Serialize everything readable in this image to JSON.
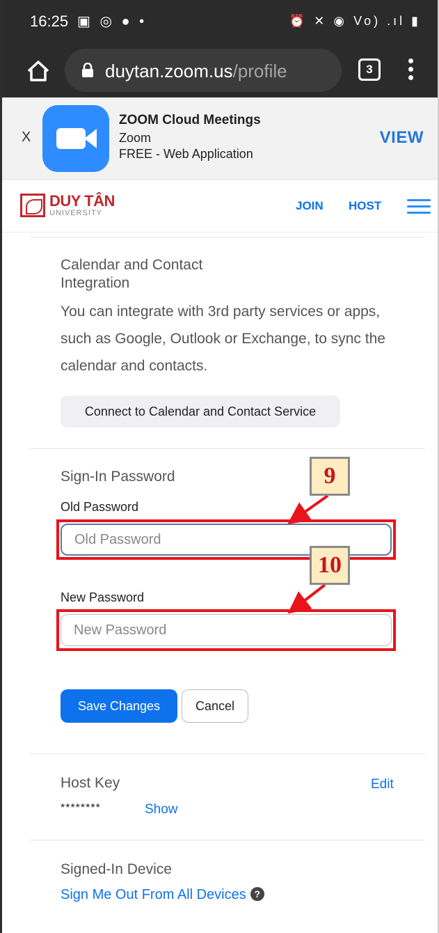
{
  "status_bar": {
    "time": "16:25",
    "left_icons": "▣ ◎ ●  •",
    "right_icons": "⏰ ✕ ◉ Vo) .ıl ▮"
  },
  "browser": {
    "url_host": "duytan.zoom.us",
    "url_path": "/profile",
    "tab_count": "3"
  },
  "app_banner": {
    "close": "X",
    "app_name": "ZOOM Cloud Meetings",
    "publisher": "Zoom",
    "price": "FREE - Web Application",
    "view_label": "VIEW"
  },
  "site_header": {
    "logo_word": "DUY TÂN",
    "logo_sub": "UNIVERSITY",
    "nav": {
      "join": "JOIN",
      "host": "HOST"
    }
  },
  "calendar_section": {
    "title_line1": "Calendar and Contact",
    "title_line2": "Integration",
    "description": "You can integrate with 3rd party services or apps, such as Google, Outlook or Exchange, to sync the calendar and contacts.",
    "connect_button": "Connect to Calendar and Contact Service"
  },
  "password_section": {
    "title": "Sign-In Password",
    "old_label": "Old Password",
    "old_placeholder": "Old Password",
    "new_label": "New Password",
    "new_placeholder": "New Password",
    "save_button": "Save Changes",
    "cancel_button": "Cancel"
  },
  "annotations": {
    "step_old": "9",
    "step_new": "10",
    "highlight_color": "#e8141c"
  },
  "host_key": {
    "title": "Host Key",
    "masked_value": "********",
    "show_link": "Show",
    "edit_link": "Edit"
  },
  "device_section": {
    "title": "Signed-In Device",
    "signout_link": "Sign Me Out From All Devices"
  },
  "colors": {
    "accent": "#0e72ed",
    "zoom_blue": "#2d8cff",
    "brand_red": "#c0272d"
  }
}
